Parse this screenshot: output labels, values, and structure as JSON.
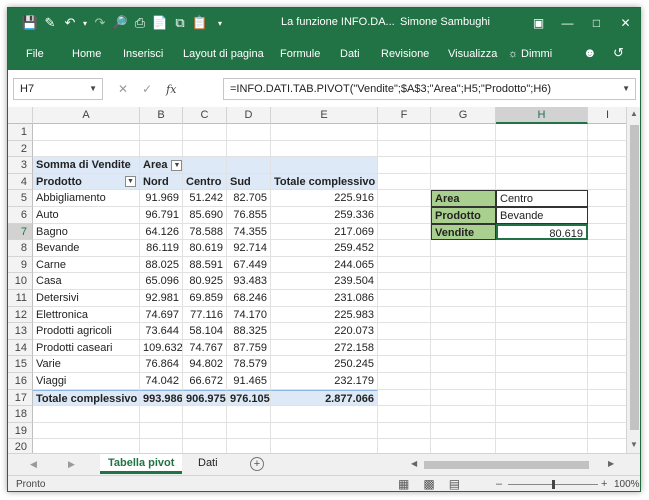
{
  "app": {
    "title": "La funzione INFO.DA...",
    "user": "Simone Sambughi"
  },
  "ribbon": {
    "tabs": [
      "File",
      "Home",
      "Inserisci",
      "Layout di pagina",
      "Formule",
      "Dati",
      "Revisione",
      "Visualizza",
      "Dimmi"
    ]
  },
  "formula_bar": {
    "name_box": "H7",
    "formula": "=INFO.DATI.TAB.PIVOT(\"Vendite\";$A$3;\"Area\";H5;\"Prodotto\";H6)"
  },
  "columns": [
    "A",
    "B",
    "C",
    "D",
    "E",
    "F",
    "G",
    "H",
    "I"
  ],
  "selected": {
    "column": "H",
    "row": "7"
  },
  "rows": [
    {
      "n": "1"
    },
    {
      "n": "2"
    },
    {
      "n": "3",
      "a": "Somma di Vendite",
      "b": "Area"
    },
    {
      "n": "4",
      "a": "Prodotto",
      "b": "Nord",
      "c": "Centro",
      "d": "Sud",
      "e": "Totale complessivo"
    },
    {
      "n": "5",
      "a": "Abbigliamento",
      "b": "91.969",
      "c": "51.242",
      "d": "82.705",
      "e": "225.916",
      "g": "Area",
      "h": "Centro"
    },
    {
      "n": "6",
      "a": "Auto",
      "b": "96.791",
      "c": "85.690",
      "d": "76.855",
      "e": "259.336",
      "g": "Prodotto",
      "h": "Bevande"
    },
    {
      "n": "7",
      "a": "Bagno",
      "b": "64.126",
      "c": "78.588",
      "d": "74.355",
      "e": "217.069",
      "g": "Vendite",
      "h": "80.619"
    },
    {
      "n": "8",
      "a": "Bevande",
      "b": "86.119",
      "c": "80.619",
      "d": "92.714",
      "e": "259.452"
    },
    {
      "n": "9",
      "a": "Carne",
      "b": "88.025",
      "c": "88.591",
      "d": "67.449",
      "e": "244.065"
    },
    {
      "n": "10",
      "a": "Casa",
      "b": "65.096",
      "c": "80.925",
      "d": "93.483",
      "e": "239.504"
    },
    {
      "n": "11",
      "a": "Detersivi",
      "b": "92.981",
      "c": "69.859",
      "d": "68.246",
      "e": "231.086"
    },
    {
      "n": "12",
      "a": "Elettronica",
      "b": "74.697",
      "c": "77.116",
      "d": "74.170",
      "e": "225.983"
    },
    {
      "n": "13",
      "a": "Prodotti agricoli",
      "b": "73.644",
      "c": "58.104",
      "d": "88.325",
      "e": "220.073"
    },
    {
      "n": "14",
      "a": "Prodotti caseari",
      "b": "109.632",
      "c": "74.767",
      "d": "87.759",
      "e": "272.158"
    },
    {
      "n": "15",
      "a": "Varie",
      "b": "76.864",
      "c": "94.802",
      "d": "78.579",
      "e": "250.245"
    },
    {
      "n": "16",
      "a": "Viaggi",
      "b": "74.042",
      "c": "66.672",
      "d": "91.465",
      "e": "232.179"
    },
    {
      "n": "17",
      "a": "Totale complessivo",
      "b": "993.986",
      "c": "906.975",
      "d": "976.105",
      "e": "2.877.066"
    },
    {
      "n": "18"
    },
    {
      "n": "19"
    },
    {
      "n": "20"
    }
  ],
  "sheets": {
    "active": "Tabella pivot",
    "other": "Dati"
  },
  "status": {
    "mode": "Pronto",
    "zoom": "100%"
  }
}
